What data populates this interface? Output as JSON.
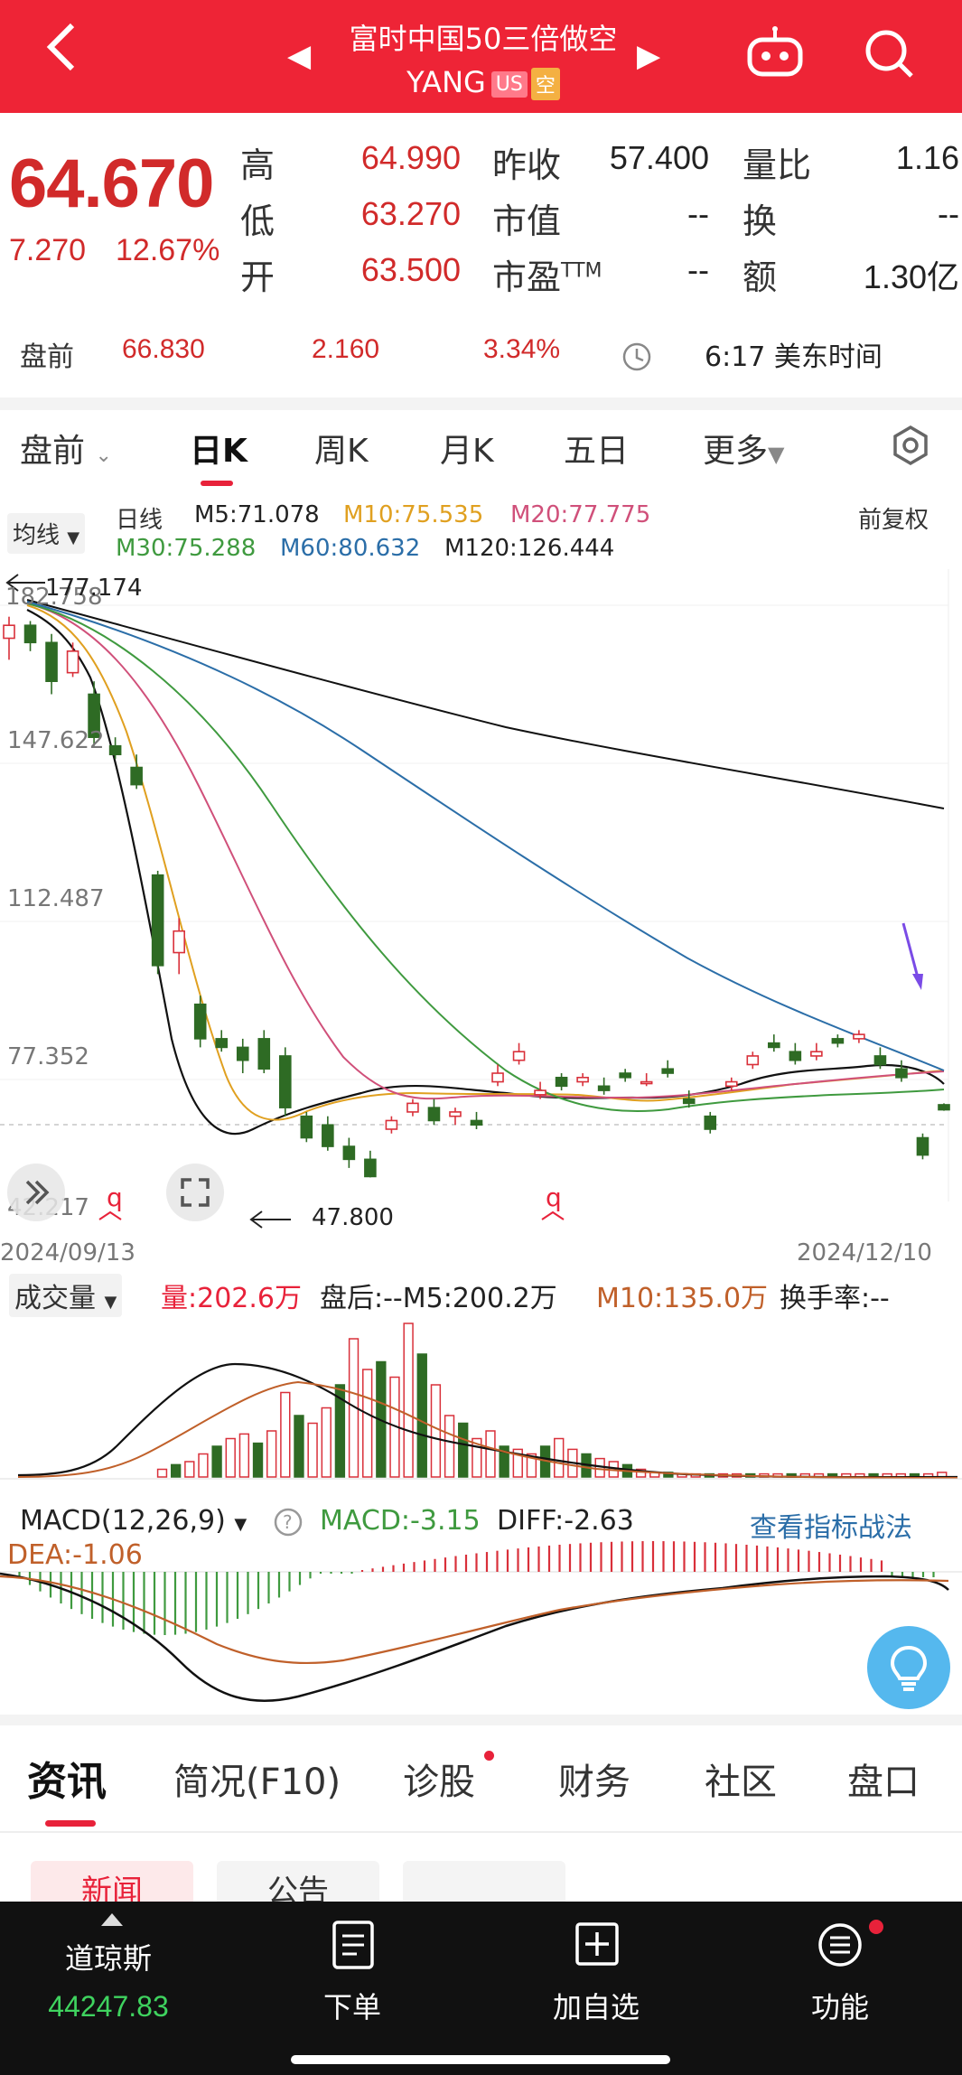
{
  "header": {
    "title": "富时中国50三倍做空",
    "ticker": "YANG",
    "badge_market": "US",
    "badge_short": "空",
    "colors": {
      "bg": "#ee2436"
    }
  },
  "quote": {
    "price": "64.670",
    "change": "7.270",
    "change_pct": "12.67%",
    "high_label": "高",
    "high": "64.990",
    "low_label": "低",
    "low": "63.270",
    "open_label": "开",
    "open": "63.500",
    "prev_close_label": "昨收",
    "prev_close": "57.400",
    "mkt_cap_label": "市值",
    "mkt_cap": "--",
    "pe_label": "市盈TTM",
    "pe": "--",
    "vol_ratio_label": "量比",
    "vol_ratio": "1.16",
    "turnover_label": "换",
    "turnover": "--",
    "amount_label": "额",
    "amount": "1.30亿"
  },
  "premarket": {
    "label": "盘前",
    "price": "66.830",
    "change": "2.160",
    "change_pct": "3.34%",
    "time": "6:17 美东时间"
  },
  "chart_tabs": {
    "items": [
      "盘前",
      "日K",
      "周K",
      "月K",
      "五日",
      "更多"
    ],
    "active": "日K"
  },
  "ma_legend": {
    "type_label": "均线",
    "period_label": "日线",
    "m5": "M5:71.078",
    "m10": "M10:75.535",
    "m20": "M20:77.775",
    "m30": "M30:75.288",
    "m60": "M60:80.632",
    "m120": "M120:126.444",
    "adjust": "前复权"
  },
  "price_axis": {
    "top": "182.758",
    "l2": "147.622",
    "l3": "112.487",
    "l4": "77.352",
    "bottom": "42.217",
    "max_marker": "177.174",
    "min_marker": "47.800",
    "start_date": "2024/09/13",
    "end_date": "2024/12/10"
  },
  "volume": {
    "label": "成交量",
    "vol": "量:202.6万",
    "after": "盘后:--",
    "m5": "M5:200.2万",
    "m10": "M10:135.0万",
    "turnover_rate": "换手率:--"
  },
  "macd": {
    "label": "MACD(12,26,9)",
    "macd": "MACD:-3.15",
    "diff": "DIFF:-2.63",
    "dea": "DEA:-1.06",
    "link": "查看指标战法"
  },
  "bottom_tabs": {
    "items": [
      "资讯",
      "简况(F10)",
      "诊股",
      "财务",
      "社区",
      "盘口"
    ],
    "active": "资讯",
    "sub_items": [
      "新闻",
      "公告"
    ]
  },
  "nav": {
    "index_name": "道琼斯",
    "index_value": "44247.83",
    "order": "下单",
    "watch": "加自选",
    "func": "功能"
  },
  "chart_data": {
    "type": "candlestick",
    "x_start": "2024/09/13",
    "x_end": "2024/12/10",
    "ylim": [
      42.217,
      182.758
    ],
    "candles": [
      [
        173,
        178,
        168,
        176
      ],
      [
        176,
        177,
        170,
        172
      ],
      [
        172,
        174,
        160,
        163
      ],
      [
        165,
        172,
        164,
        170
      ],
      [
        160,
        163,
        148,
        150
      ],
      [
        148,
        150,
        145,
        146
      ],
      [
        143,
        146,
        138,
        139
      ],
      [
        118,
        119,
        95,
        97
      ],
      [
        100,
        108,
        95,
        105
      ],
      [
        88,
        90,
        78,
        80
      ],
      [
        80,
        82,
        77,
        78
      ],
      [
        78,
        80,
        72,
        75
      ],
      [
        80,
        82,
        72,
        73
      ],
      [
        76,
        78,
        62,
        64
      ],
      [
        62,
        63,
        56,
        57
      ],
      [
        60,
        62,
        54,
        55
      ],
      [
        55,
        57,
        50,
        52
      ],
      [
        52,
        54,
        47.8,
        48
      ],
      [
        59,
        62,
        58,
        61
      ],
      [
        63,
        66,
        62,
        65
      ],
      [
        64,
        66,
        60,
        61
      ],
      [
        62,
        64,
        60,
        63
      ],
      [
        61,
        63,
        59,
        60
      ],
      [
        70,
        74,
        69,
        72
      ],
      [
        75,
        79,
        74,
        77
      ],
      [
        67,
        70,
        66,
        68
      ],
      [
        71,
        72,
        68,
        69
      ],
      [
        70,
        72,
        69,
        71
      ],
      [
        69,
        71,
        67,
        68
      ],
      [
        72,
        73,
        70,
        71
      ],
      [
        70,
        72,
        69,
        70
      ],
      [
        73,
        75,
        71,
        72
      ],
      [
        66,
        68,
        64,
        65
      ],
      [
        62,
        63,
        58,
        59
      ],
      [
        69,
        71,
        68,
        70
      ],
      [
        74,
        77,
        73,
        76
      ],
      [
        79,
        81,
        77,
        78
      ],
      [
        77,
        79,
        74,
        75
      ],
      [
        76,
        79,
        75,
        77
      ],
      [
        80,
        81,
        78,
        79
      ],
      [
        80,
        82,
        79,
        81
      ],
      [
        76,
        78,
        73,
        74
      ],
      [
        73,
        75,
        70,
        71
      ],
      [
        57,
        58,
        52,
        53
      ],
      [
        64.67,
        65,
        63.27,
        63.5
      ]
    ],
    "ma_values": {
      "M5": 71.078,
      "M10": 75.535,
      "M20": 77.775,
      "M30": 75.288,
      "M60": 80.632,
      "M120": 126.444
    }
  }
}
